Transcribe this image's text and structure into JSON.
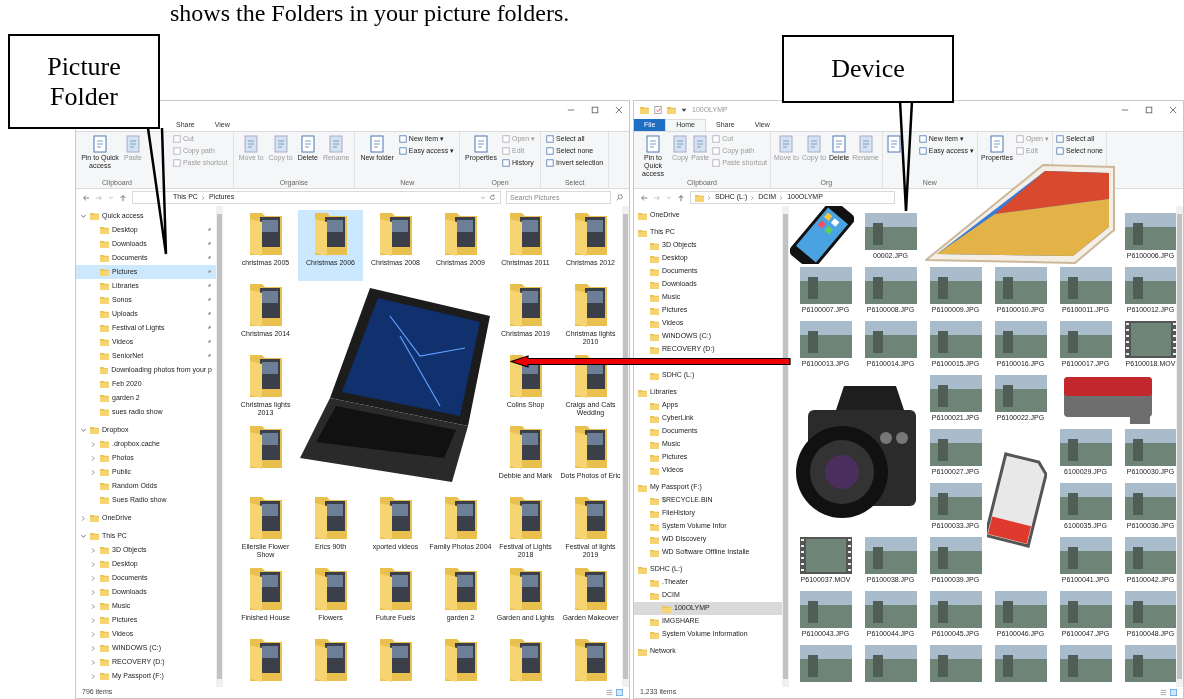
{
  "caption": "shows the Folders in your picture folders.",
  "callouts": [
    {
      "text": "Picture Folder"
    },
    {
      "text": "Device"
    }
  ],
  "windows": [
    {
      "tabs": [
        {
          "label": "Share",
          "selected": false
        },
        {
          "label": "View",
          "selected": false
        }
      ],
      "ribbon": [
        {
          "label": "Clipboard",
          "items": [
            {
              "label": "Pin to Quick access",
              "kind": "large",
              "disabled": false
            },
            {
              "label": "Paste",
              "kind": "large",
              "disabled": true
            },
            {
              "label": "Cut",
              "kind": "small",
              "disabled": true
            },
            {
              "label": "Copy path",
              "kind": "small",
              "disabled": true
            },
            {
              "label": "Paste shortcut",
              "kind": "small",
              "disabled": true
            }
          ]
        },
        {
          "label": "Organise",
          "items": [
            {
              "label": "Move to",
              "kind": "large",
              "disabled": true
            },
            {
              "label": "Copy to",
              "kind": "large",
              "disabled": true
            },
            {
              "label": "Delete",
              "kind": "large",
              "disabled": false
            },
            {
              "label": "Rename",
              "kind": "large",
              "disabled": true
            }
          ]
        },
        {
          "label": "New",
          "items": [
            {
              "label": "New folder",
              "kind": "large",
              "disabled": false
            },
            {
              "label": "New item ▾",
              "kind": "small",
              "disabled": false
            },
            {
              "label": "Easy access ▾",
              "kind": "small",
              "disabled": false
            }
          ]
        },
        {
          "label": "Open",
          "items": [
            {
              "label": "Properties",
              "kind": "large",
              "disabled": false
            },
            {
              "label": "Open ▾",
              "kind": "small",
              "disabled": true
            },
            {
              "label": "Edit",
              "kind": "small",
              "disabled": true
            },
            {
              "label": "History",
              "kind": "small",
              "disabled": false
            }
          ]
        },
        {
          "label": "Select",
          "items": [
            {
              "label": "Select all",
              "kind": "small",
              "disabled": false
            },
            {
              "label": "Select none",
              "kind": "small",
              "disabled": false
            },
            {
              "label": "Invert selection",
              "kind": "small",
              "disabled": false
            }
          ]
        }
      ],
      "address": [
        "This PC",
        "Pictures"
      ],
      "search": {
        "placeholder": "Search Pictures"
      },
      "nav": [
        {
          "label": "Quick access",
          "expanded": true,
          "selected": false,
          "children": [
            {
              "label": "Desktop",
              "selected": false,
              "pinned": true
            },
            {
              "label": "Downloads",
              "selected": false,
              "pinned": true
            },
            {
              "label": "Documents",
              "selected": false,
              "pinned": true
            },
            {
              "label": "Pictures",
              "selected": true,
              "pinned": true
            },
            {
              "label": "Libraries",
              "selected": false,
              "pinned": true
            },
            {
              "label": "Sonos",
              "selected": false,
              "pinned": true
            },
            {
              "label": "Uploads",
              "selected": false,
              "pinned": true
            },
            {
              "label": "Festival of Lights",
              "selected": false,
              "pinned": true
            },
            {
              "label": "Videos",
              "selected": false,
              "pinned": true
            },
            {
              "label": "SeniorNet",
              "selected": false,
              "pinned": true
            },
            {
              "label": "Downloading photos from your p",
              "selected": false,
              "pinned": false
            },
            {
              "label": "Feb 2020",
              "selected": false,
              "pinned": false
            },
            {
              "label": "garden 2",
              "selected": false,
              "pinned": false
            },
            {
              "label": "sues radio show",
              "selected": false,
              "pinned": false
            }
          ]
        },
        {
          "label": "Dropbox",
          "expanded": true,
          "selected": false,
          "children": [
            {
              "label": ".dropbox.cache",
              "expanded": false,
              "selected": false
            },
            {
              "label": "Photos",
              "expanded": false,
              "selected": false
            },
            {
              "label": "Public",
              "expanded": false,
              "selected": false
            },
            {
              "label": "Random Odds",
              "selected": false
            },
            {
              "label": "Sues Radio show",
              "selected": false
            }
          ]
        },
        {
          "label": "OneDrive",
          "expanded": false,
          "selected": false
        },
        {
          "label": "This PC",
          "expanded": true,
          "selected": false,
          "children": [
            {
              "label": "3D Objects",
              "expanded": false,
              "selected": false
            },
            {
              "label": "Desktop",
              "expanded": false,
              "selected": false
            },
            {
              "label": "Documents",
              "expanded": false,
              "selected": false
            },
            {
              "label": "Downloads",
              "expanded": false,
              "selected": false
            },
            {
              "label": "Music",
              "expanded": false,
              "selected": false
            },
            {
              "label": "Pictures",
              "expanded": false,
              "selected": false
            },
            {
              "label": "Videos",
              "expanded": false,
              "selected": false
            },
            {
              "label": "WINDOWS (C:)",
              "expanded": false,
              "selected": false
            },
            {
              "label": "RECOVERY (D:)",
              "expanded": false,
              "selected": false
            },
            {
              "label": "My Passport (F:)",
              "expanded": false,
              "selected": false
            }
          ]
        }
      ],
      "items": [
        {
          "kind": "folder",
          "label": "christmas 2005",
          "selected": false
        },
        {
          "kind": "folder",
          "label": "Christmas 2006",
          "selected": true
        },
        {
          "kind": "folder",
          "label": "Christmas 2008",
          "selected": false
        },
        {
          "kind": "folder",
          "label": "Christmas 2009",
          "selected": false
        },
        {
          "kind": "folder",
          "label": "Christmas 2011",
          "selected": false
        },
        {
          "kind": "folder",
          "label": "Christmas 2012",
          "selected": false
        },
        {
          "kind": "folder",
          "label": "Christmas 2014",
          "selected": false
        },
        {
          "kind": "hidden"
        },
        {
          "kind": "hidden"
        },
        {
          "kind": "hidden"
        },
        {
          "kind": "folder",
          "label": "Christmas 2019",
          "selected": false
        },
        {
          "kind": "folder",
          "label": "Christmas lights 2010",
          "selected": false
        },
        {
          "kind": "folder",
          "label": "Christmas lights 2013",
          "selected": false
        },
        {
          "kind": "hidden"
        },
        {
          "kind": "hidden"
        },
        {
          "kind": "hidden"
        },
        {
          "kind": "folder",
          "label": "Colins Shop",
          "selected": false
        },
        {
          "kind": "folder",
          "label": "Craigs and Cats Wedding",
          "selected": false
        },
        {
          "kind": "folder",
          "selected": false
        },
        {
          "kind": "hidden"
        },
        {
          "kind": "hidden"
        },
        {
          "kind": "hidden"
        },
        {
          "kind": "folder",
          "label": "Debbie and Mark",
          "selected": false
        },
        {
          "kind": "folder",
          "label": "Dots Photos of Eric",
          "selected": false
        },
        {
          "kind": "folder",
          "label": "Ellerslie Flower Show",
          "selected": false
        },
        {
          "kind": "folder",
          "label": "Erics 90th",
          "selected": false
        },
        {
          "kind": "folder",
          "label": "xported videos",
          "selected": false
        },
        {
          "kind": "folder",
          "label": "Family Photos 2004",
          "selected": false
        },
        {
          "kind": "folder",
          "label": "Festival of Lights 2018",
          "selected": false
        },
        {
          "kind": "folder",
          "label": "Festival of lights 2019",
          "selected": false
        },
        {
          "kind": "folder",
          "label": "Finished House",
          "selected": false
        },
        {
          "kind": "folder",
          "label": "Flowers",
          "selected": false
        },
        {
          "kind": "folder",
          "label": "Future Fuels",
          "selected": false
        },
        {
          "kind": "folder",
          "label": "garden 2",
          "selected": false
        },
        {
          "kind": "folder",
          "label": "Garden and Lights",
          "selected": false
        },
        {
          "kind": "folder",
          "label": "Garden Makeover",
          "selected": false
        },
        {
          "kind": "folder",
          "selected": false
        },
        {
          "kind": "folder",
          "selected": false
        },
        {
          "kind": "folder",
          "selected": false
        },
        {
          "kind": "folder",
          "selected": false
        },
        {
          "kind": "folder",
          "selected": false
        },
        {
          "kind": "folder",
          "selected": false
        }
      ],
      "status": "796 items"
    },
    {
      "title": "100OLYMP",
      "tabs": [
        {
          "label": "File",
          "kind": "file",
          "selected": false
        },
        {
          "label": "Home",
          "kind": "tab",
          "selected": true
        },
        {
          "label": "Share",
          "kind": "tab",
          "selected": false
        },
        {
          "label": "View",
          "kind": "tab",
          "selected": false
        }
      ],
      "ribbon": [
        {
          "label": "Clipboard",
          "items": [
            {
              "label": "Pin to Quick access",
              "kind": "large",
              "disabled": false
            },
            {
              "label": "Copy",
              "kind": "large",
              "disabled": true
            },
            {
              "label": "Paste",
              "kind": "large",
              "disabled": true
            },
            {
              "label": "Cut",
              "kind": "small",
              "disabled": true
            },
            {
              "label": "Copy path",
              "kind": "small",
              "disabled": true
            },
            {
              "label": "Paste shortcut",
              "kind": "small",
              "disabled": true
            }
          ]
        },
        {
          "label": "Org",
          "items": [
            {
              "label": "Move to",
              "kind": "large",
              "disabled": true
            },
            {
              "label": "Copy to",
              "kind": "large",
              "disabled": true
            },
            {
              "label": "Delete",
              "kind": "large",
              "disabled": false
            },
            {
              "label": "Rename",
              "kind": "large",
              "disabled": true
            }
          ]
        },
        {
          "label": "New",
          "items": [
            {
              "kind": "large",
              "disabled": false
            },
            {
              "label": "New item ▾",
              "kind": "small",
              "disabled": false
            },
            {
              "label": "Easy access ▾",
              "kind": "small",
              "disabled": false
            }
          ]
        },
        {
          "items": [
            {
              "label": "Properties",
              "kind": "large",
              "disabled": false
            },
            {
              "label": "Open ▾",
              "kind": "small",
              "disabled": true
            },
            {
              "label": "Edit",
              "kind": "small",
              "disabled": true
            }
          ]
        },
        {
          "items": [
            {
              "label": "Select all",
              "kind": "small",
              "disabled": false
            },
            {
              "label": "Select none",
              "kind": "small",
              "disabled": false
            }
          ]
        }
      ],
      "address": [
        "SDHC (L:)",
        "DCIM",
        "100OLYMP"
      ],
      "nav": [
        {
          "label": "OneDrive",
          "selected": false
        },
        {
          "label": "This PC",
          "selected": false,
          "children": [
            {
              "label": "3D Objects",
              "selected": false
            },
            {
              "label": "Desktop",
              "selected": false
            },
            {
              "label": "Documents",
              "selected": false
            },
            {
              "label": "Downloads",
              "selected": false
            },
            {
              "label": "Music",
              "selected": false
            },
            {
              "label": "Pictures",
              "selected": false
            },
            {
              "label": "Videos",
              "selected": false
            },
            {
              "label": "WINDOWS (C:)",
              "selected": false
            },
            {
              "label": "RECOVERY (D:)",
              "selected": false
            },
            {
              "kind": "hidden"
            },
            {
              "label": "SDHC (L:)",
              "selected": false
            }
          ]
        },
        {
          "label": "Libraries",
          "selected": false,
          "children": [
            {
              "label": "Apps",
              "selected": false
            },
            {
              "label": "CyberLink",
              "selected": false
            },
            {
              "label": "Documents",
              "selected": false
            },
            {
              "label": "Music",
              "selected": false
            },
            {
              "label": "Pictures",
              "selected": false
            },
            {
              "label": "Videos",
              "selected": false
            }
          ]
        },
        {
          "label": "My Passport (F:)",
          "selected": false,
          "children": [
            {
              "label": "$RECYCLE.BIN",
              "selected": false
            },
            {
              "label": "FileHistory",
              "selected": false
            },
            {
              "label": "System Volume Infor",
              "selected": false
            },
            {
              "label": "WD Discovery",
              "selected": false
            },
            {
              "label": "WD Software Offline Installe",
              "selected": false
            }
          ]
        },
        {
          "label": "SDHC (L:)",
          "selected": false,
          "children": [
            {
              "label": ".Theater",
              "selected": false
            },
            {
              "label": "DCIM",
              "selected": false,
              "children": [
                {
                  "label": "100OLYMP",
                  "selected": true
                }
              ]
            },
            {
              "label": "IMGSHARE",
              "selected": false
            },
            {
              "label": "System Volume Information",
              "selected": false
            }
          ]
        },
        {
          "label": "Network",
          "selected": false
        }
      ],
      "items": [
        {
          "kind": "hidden"
        },
        {
          "label": "00002.JPG",
          "kind": "photo"
        },
        {
          "kind": "hidden"
        },
        {
          "kind": "hidden"
        },
        {
          "kind": "hidden"
        },
        {
          "label": "P6100006.JPG",
          "kind": "photo"
        },
        {
          "label": "P6100007.JPG",
          "kind": "photo"
        },
        {
          "label": "P6100008.JPG",
          "kind": "photo"
        },
        {
          "label": "P6100009.JPG",
          "kind": "photo"
        },
        {
          "label": "P6100010.JPG",
          "kind": "photo"
        },
        {
          "label": "P6100011.JPG",
          "kind": "photo"
        },
        {
          "label": "P6100012.JPG",
          "kind": "photo"
        },
        {
          "label": "P6100013.JPG",
          "kind": "photo"
        },
        {
          "label": "P6100014.JPG",
          "kind": "photo"
        },
        {
          "label": "P6100015.JPG",
          "kind": "photo"
        },
        {
          "label": "P6100016.JPG",
          "kind": "photo"
        },
        {
          "label": "P6100017.JPG",
          "kind": "photo"
        },
        {
          "label": "P6100018.MOV",
          "kind": "video"
        },
        {
          "kind": "hidden"
        },
        {
          "kind": "hidden"
        },
        {
          "label": "P6100021.JPG",
          "kind": "photo"
        },
        {
          "label": "P6100022.JPG",
          "kind": "photo"
        },
        {
          "kind": "hidden"
        },
        {
          "kind": "hidden"
        },
        {
          "kind": "hidden"
        },
        {
          "kind": "hidden"
        },
        {
          "label": "P6100027.JPG",
          "kind": "photo"
        },
        {
          "kind": "hidden"
        },
        {
          "label": "6100029.JPG",
          "kind": "photo"
        },
        {
          "label": "P6100030.JPG",
          "kind": "photo"
        },
        {
          "kind": "hidden"
        },
        {
          "kind": "hidden"
        },
        {
          "label": "P6100033.JPG",
          "kind": "photo"
        },
        {
          "kind": "hidden"
        },
        {
          "label": "6100035.JPG",
          "kind": "photo"
        },
        {
          "label": "P6100036.JPG",
          "kind": "photo"
        },
        {
          "label": "P6100037.MOV",
          "kind": "video"
        },
        {
          "label": "P6100038.JPG",
          "kind": "photo"
        },
        {
          "label": "P6100039.JPG",
          "kind": "photo"
        },
        {
          "kind": "hidden"
        },
        {
          "label": "P6100041.JPG",
          "kind": "photo"
        },
        {
          "label": "P6100042.JPG",
          "kind": "photo"
        },
        {
          "label": "P6100043.JPG",
          "kind": "photo"
        },
        {
          "label": "P6100044.JPG",
          "kind": "photo"
        },
        {
          "label": "P6100045.JPG",
          "kind": "photo"
        },
        {
          "label": "P6100046.JPG",
          "kind": "photo"
        },
        {
          "label": "P6100047.JPG",
          "kind": "photo"
        },
        {
          "label": "P6100048.JPG",
          "kind": "photo"
        },
        {
          "kind": "photo"
        },
        {
          "kind": "photo"
        },
        {
          "kind": "photo"
        },
        {
          "kind": "photo"
        },
        {
          "kind": "photo"
        },
        {
          "kind": "photo"
        }
      ],
      "status": "1,233 items"
    }
  ]
}
